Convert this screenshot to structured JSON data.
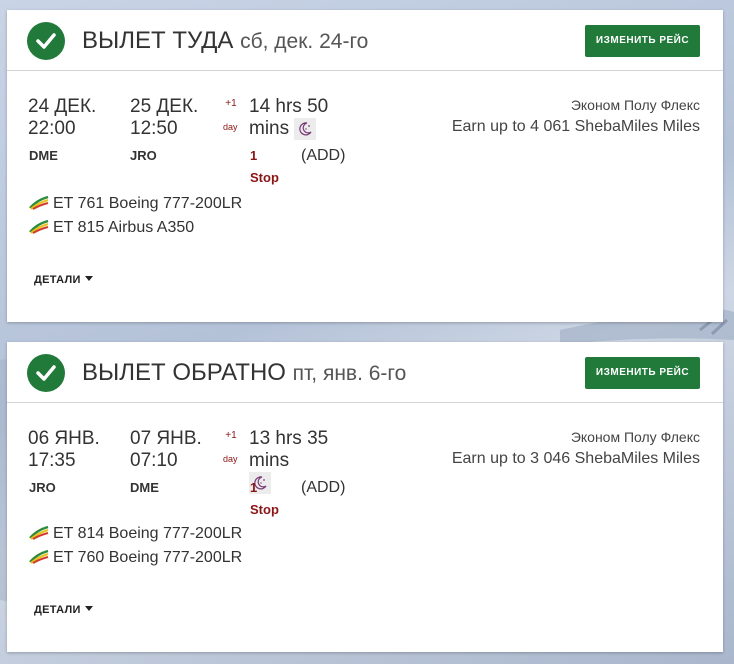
{
  "colors": {
    "accent_green": "#217a3a",
    "stop_red": "#8b1515",
    "text": "#333333"
  },
  "outbound": {
    "header_title": "ВЫЛЕТ ТУДА",
    "header_date": "сб, дек. 24-го",
    "change_label": "Изменить рейс",
    "dep_date": "24 ДЕК.",
    "dep_time": "22:00",
    "dep_airport": "DME",
    "arr_date": "25 ДЕК.",
    "arr_time": "12:50",
    "arr_airport": "JRO",
    "day_offset": "+1",
    "day_label": "day",
    "duration_line1": "14 hrs 50",
    "duration_line2": "mins",
    "stops_count": "1",
    "stops_label": "Stop",
    "stop_airport": "(ADD)",
    "fare_name": "Эконом Полу Флекс",
    "miles": "Earn up to 4 061 ShebaMiles Miles",
    "flights": [
      "ET 761 Boeing 777-200LR",
      "ET 815 Airbus A350"
    ],
    "details_label": "ДЕТАЛИ"
  },
  "inbound": {
    "header_title": "ВЫЛЕТ ОБРАТНО",
    "header_date": "пт, янв. 6-го",
    "change_label": "Изменить рейс",
    "dep_date": "06 ЯНВ.",
    "dep_time": "17:35",
    "dep_airport": "JRO",
    "arr_date": "07 ЯНВ.",
    "arr_time": "07:10",
    "arr_airport": "DME",
    "day_offset": "+1",
    "day_label": "day",
    "duration_line1": "13 hrs 35 mins",
    "stops_count": "1",
    "stops_label": "Stop",
    "stop_airport": "(ADD)",
    "fare_name": "Эконом Полу Флекс",
    "miles": "Earn up to 3 046 ShebaMiles Miles",
    "flights": [
      "ET 814 Boeing 777-200LR",
      "ET 760 Boeing 777-200LR"
    ],
    "details_label": "ДЕТАЛИ"
  },
  "icons": {
    "check": "check-circle-icon",
    "night": "moon-stars-icon",
    "airline": "ethiopian-airlines-logo-icon",
    "caret": "caret-down-icon"
  }
}
